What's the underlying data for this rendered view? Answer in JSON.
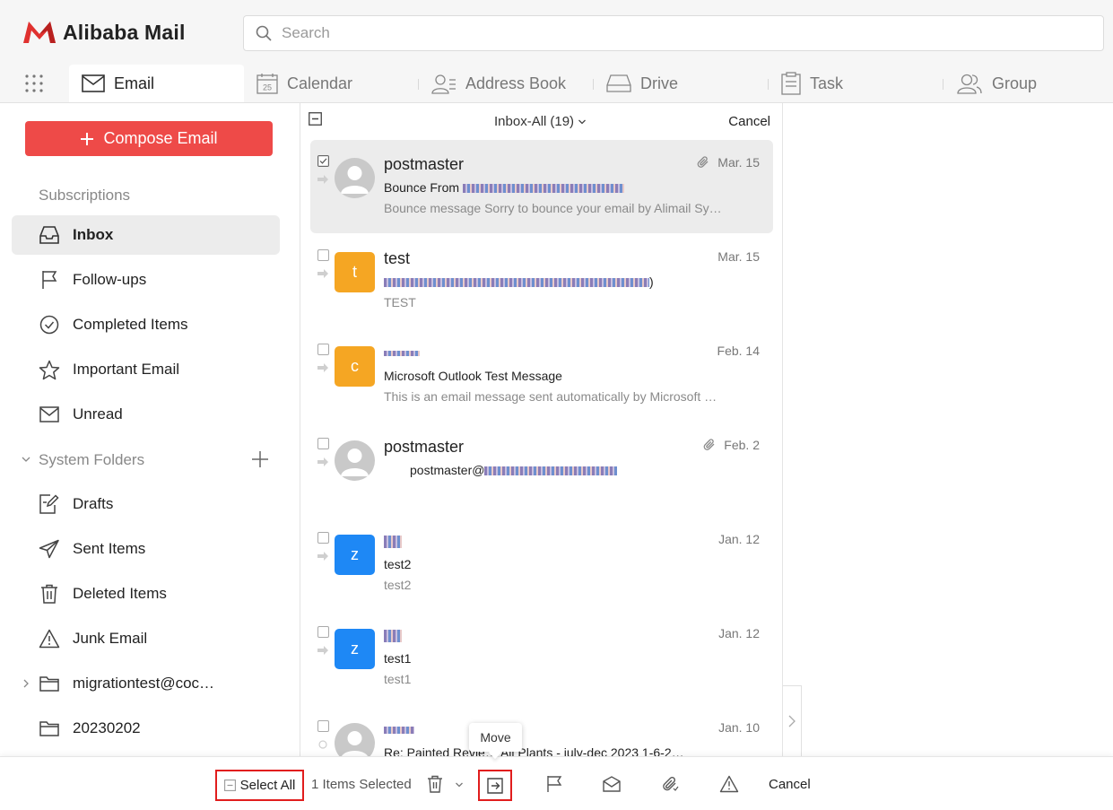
{
  "app": {
    "name": "Alibaba Mail",
    "brand_color": "#e0312f"
  },
  "search": {
    "placeholder": "Search"
  },
  "tabs": [
    {
      "label": "Email",
      "icon": "mail-icon",
      "active": true
    },
    {
      "label": "Calendar",
      "icon": "calendar-icon",
      "badge": "25"
    },
    {
      "label": "Address Book",
      "icon": "address-book-icon"
    },
    {
      "label": "Drive",
      "icon": "drive-icon"
    },
    {
      "label": "Task",
      "icon": "task-icon"
    },
    {
      "label": "Group",
      "icon": "group-icon"
    }
  ],
  "sidebar": {
    "compose_label": "Compose Email",
    "compose_color": "#ee4a48",
    "subscriptions_label": "Subscriptions",
    "system_folders_label": "System Folders",
    "items": [
      {
        "label": "Inbox",
        "icon": "inbox-icon",
        "active": true
      },
      {
        "label": "Follow-ups",
        "icon": "flag-icon"
      },
      {
        "label": "Completed Items",
        "icon": "check-circle-icon"
      },
      {
        "label": "Important Email",
        "icon": "star-icon"
      },
      {
        "label": "Unread",
        "icon": "envelope-icon"
      }
    ],
    "folders": [
      {
        "label": "Drafts",
        "icon": "drafts-icon"
      },
      {
        "label": "Sent Items",
        "icon": "send-icon"
      },
      {
        "label": "Deleted Items",
        "icon": "trash-icon"
      },
      {
        "label": "Junk Email",
        "icon": "warning-icon"
      },
      {
        "label": "migrationtest@coc…",
        "icon": "folder-icon"
      },
      {
        "label": "20230202",
        "icon": "folder-icon"
      }
    ]
  },
  "list": {
    "folder_label": "Inbox-All",
    "count": "(19)",
    "cancel_label": "Cancel",
    "emails": [
      {
        "sender": "postmaster",
        "date": "Mar. 15",
        "subject": "Bounce From",
        "preview": "Bounce message Sorry to bounce your email by Alimail Sy…",
        "selected": true,
        "attachment": true
      },
      {
        "sender": "test",
        "date": "Mar. 15",
        "subject": ")",
        "preview": "TEST",
        "avatar_letter": "t",
        "avatar_color": "#f5a623"
      },
      {
        "sender": "",
        "date": "Feb. 14",
        "subject": "Microsoft Outlook Test Message",
        "preview": "This is an email message sent automatically by Microsoft …",
        "avatar_letter": "c",
        "avatar_color": "#f5a623"
      },
      {
        "sender": "postmaster",
        "date": "Feb. 2",
        "subject": "postmaster@",
        "preview": "",
        "attachment": true
      },
      {
        "sender": "",
        "date": "Jan. 12",
        "subject": "test2",
        "preview": "test2",
        "avatar_letter": "z",
        "avatar_color": "#1e88f5"
      },
      {
        "sender": "",
        "date": "Jan. 12",
        "subject": "test1",
        "preview": "test1",
        "avatar_letter": "z",
        "avatar_color": "#1e88f5"
      },
      {
        "sender": "",
        "date": "Jan. 10",
        "subject": "Re: Painted Revie… All Plants - july-dec 2023 1-6-2…",
        "preview": ""
      }
    ]
  },
  "toolbar": {
    "select_all_label": "Select All",
    "selected_count_label": "1 Items Selected",
    "move_tooltip": "Move",
    "cancel_label": "Cancel",
    "highlight_color": "#e11d1d"
  }
}
